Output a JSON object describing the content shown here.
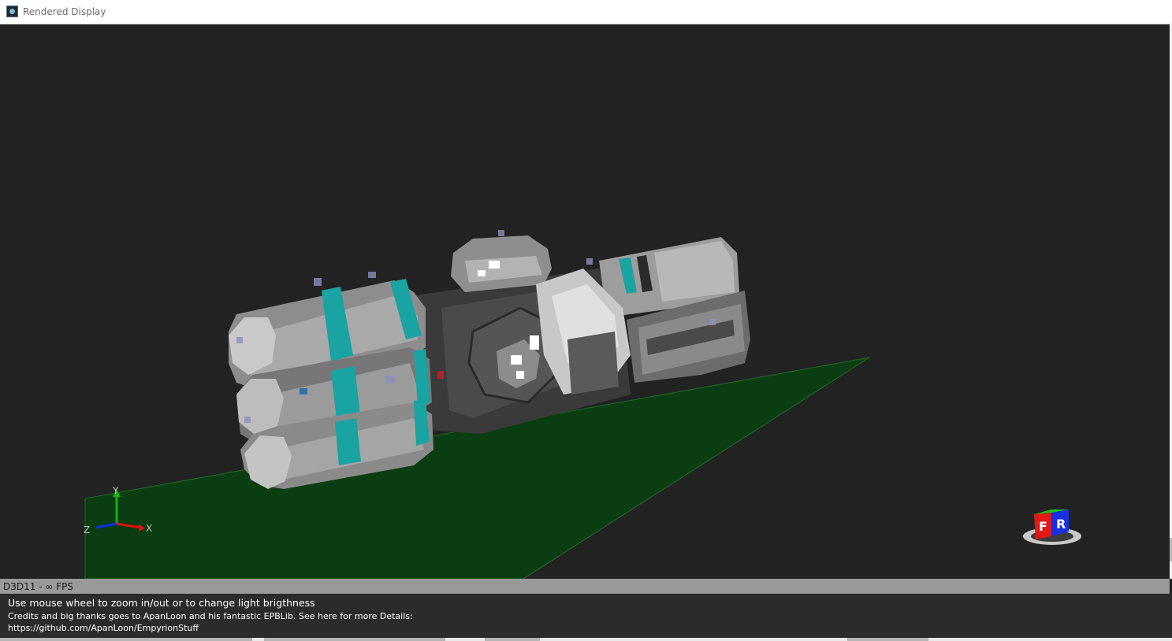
{
  "window": {
    "title": "Rendered Display"
  },
  "viewport": {
    "axis_labels": {
      "y": "Y",
      "z": "Z",
      "x": "X"
    },
    "orientation_cube": {
      "front_face": "F",
      "right_face": "R"
    },
    "colors": {
      "background": "#222222",
      "ground_plane": "#0a3d12",
      "hull": "#9a9a9a",
      "accent": "#1aa3a3",
      "axis_x": "#e01010",
      "axis_y": "#18b018",
      "axis_z": "#1030e0"
    }
  },
  "status": {
    "fps": "D3D11 - ∞ FPS"
  },
  "info": {
    "hint": "Use mouse wheel to zoom in/out or to change light brigthness",
    "credits": "Credits and big thanks goes to ApanLoon and his fantastic EPBLib. See here for more Details:",
    "link": "https://github.com/ApanLoon/EmpyrionStuff"
  }
}
